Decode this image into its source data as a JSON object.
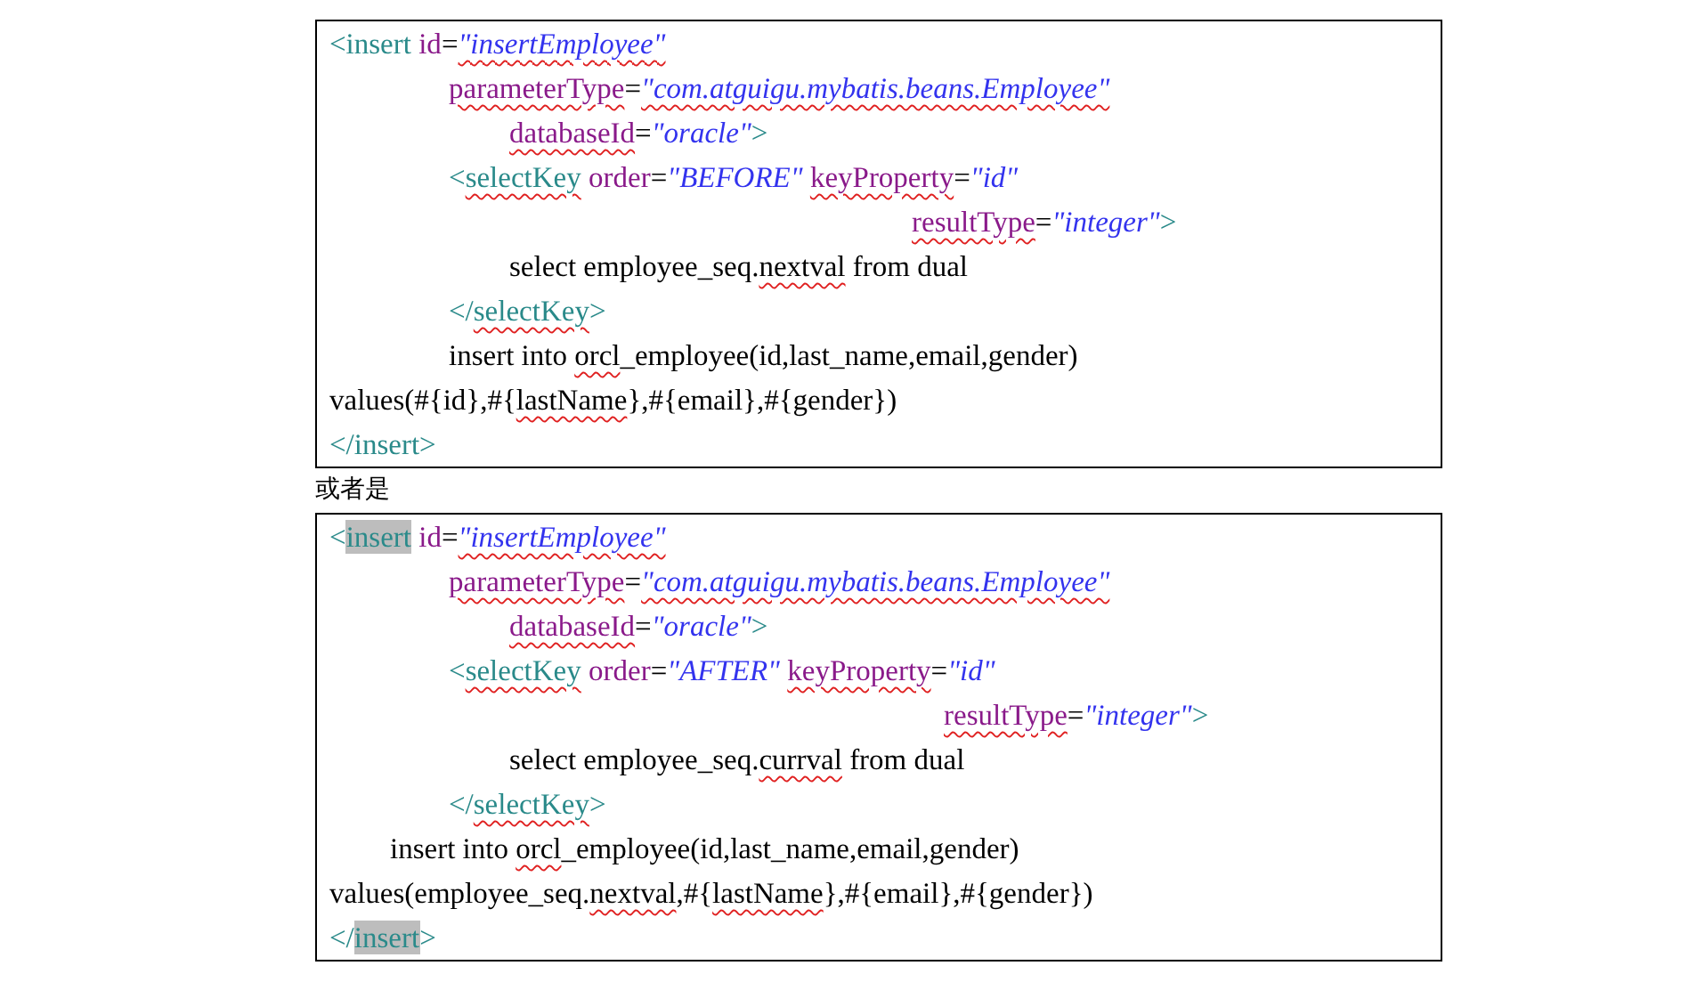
{
  "document": [
    {
      "kind": "code",
      "lines": [
        {
          "kind": "flush",
          "tokens": [
            {
              "text": "<insert",
              "kind": "tag",
              "misspelled": false,
              "highlighted": false
            },
            {
              "text": " id",
              "kind": "attr",
              "misspelled": false,
              "highlighted": false
            },
            {
              "text": "=",
              "kind": "plain",
              "misspelled": false,
              "highlighted": false
            },
            {
              "text": "\"insertEmployee\"",
              "kind": "value",
              "misspelled": true,
              "highlighted": false
            }
          ]
        },
        {
          "kind": "medium",
          "tokens": [
            {
              "text": "parameterType",
              "kind": "attr",
              "misspelled": true,
              "highlighted": false
            },
            {
              "text": "=",
              "kind": "plain",
              "misspelled": false,
              "highlighted": false
            },
            {
              "text": "\"com.atguigu.mybatis.beans.Employee\"",
              "kind": "value",
              "misspelled": true,
              "highlighted": false
            }
          ]
        },
        {
          "kind": "deep",
          "tokens": [
            {
              "text": "databaseId",
              "kind": "attr",
              "misspelled": true,
              "highlighted": false
            },
            {
              "text": "=",
              "kind": "plain",
              "misspelled": false,
              "highlighted": false
            },
            {
              "text": "\"oracle\"",
              "kind": "value",
              "misspelled": false,
              "highlighted": false
            },
            {
              "text": ">",
              "kind": "tag",
              "misspelled": false,
              "highlighted": false
            }
          ]
        },
        {
          "kind": "medium",
          "tokens": [
            {
              "text": "<",
              "kind": "tag",
              "misspelled": false,
              "highlighted": false
            },
            {
              "text": "selectKey",
              "kind": "tag",
              "misspelled": true,
              "highlighted": false
            },
            {
              "text": " order",
              "kind": "attr",
              "misspelled": false,
              "highlighted": false
            },
            {
              "text": "=",
              "kind": "plain",
              "misspelled": false,
              "highlighted": false
            },
            {
              "text": "\"BEFORE\" ",
              "kind": "value",
              "misspelled": false,
              "highlighted": false
            },
            {
              "text": "keyProperty",
              "kind": "attr",
              "misspelled": true,
              "highlighted": false
            },
            {
              "text": "=",
              "kind": "plain",
              "misspelled": false,
              "highlighted": false
            },
            {
              "text": "\"id\"",
              "kind": "value",
              "misspelled": false,
              "highlighted": false
            }
          ]
        },
        {
          "kind": "far",
          "tokens": [
            {
              "text": "resultType",
              "kind": "attr",
              "misspelled": true,
              "highlighted": false
            },
            {
              "text": "=",
              "kind": "plain",
              "misspelled": false,
              "highlighted": false
            },
            {
              "text": "\"integer\"",
              "kind": "value",
              "misspelled": false,
              "highlighted": false
            },
            {
              "text": ">",
              "kind": "tag",
              "misspelled": false,
              "highlighted": false
            }
          ]
        },
        {
          "kind": "deep",
          "tokens": [
            {
              "text": "select employee_seq.",
              "kind": "plain",
              "misspelled": false,
              "highlighted": false
            },
            {
              "text": "nextval",
              "kind": "plain",
              "misspelled": true,
              "highlighted": false
            },
            {
              "text": " from dual",
              "kind": "plain",
              "misspelled": false,
              "highlighted": false
            }
          ]
        },
        {
          "kind": "medium",
          "tokens": [
            {
              "text": "</",
              "kind": "tag",
              "misspelled": false,
              "highlighted": false
            },
            {
              "text": "selectKey",
              "kind": "tag",
              "misspelled": true,
              "highlighted": false
            },
            {
              "text": ">",
              "kind": "tag",
              "misspelled": false,
              "highlighted": false
            }
          ]
        },
        {
          "kind": "medium",
          "tokens": [
            {
              "text": "insert into ",
              "kind": "plain",
              "misspelled": false,
              "highlighted": false
            },
            {
              "text": "orcl",
              "kind": "plain",
              "misspelled": true,
              "highlighted": false
            },
            {
              "text": "_employee(id,last_name,email,gender)",
              "kind": "plain",
              "misspelled": false,
              "highlighted": false
            }
          ]
        },
        {
          "kind": "flush",
          "tokens": [
            {
              "text": "values(#{id},#{",
              "kind": "plain",
              "misspelled": false,
              "highlighted": false
            },
            {
              "text": "lastName",
              "kind": "plain",
              "misspelled": true,
              "highlighted": false
            },
            {
              "text": "},#{email},#{gender})",
              "kind": "plain",
              "misspelled": false,
              "highlighted": false
            }
          ]
        },
        {
          "kind": "flush",
          "tokens": [
            {
              "text": "</insert>",
              "kind": "tag",
              "misspelled": false,
              "highlighted": false
            }
          ]
        }
      ]
    },
    {
      "kind": "text",
      "text": "或者是"
    },
    {
      "kind": "code",
      "lines": [
        {
          "kind": "flush",
          "tokens": [
            {
              "text": "<",
              "kind": "tag",
              "misspelled": false,
              "highlighted": false
            },
            {
              "text": "insert",
              "kind": "tag",
              "misspelled": false,
              "highlighted": true
            },
            {
              "text": " id",
              "kind": "attr",
              "misspelled": false,
              "highlighted": false
            },
            {
              "text": "=",
              "kind": "plain",
              "misspelled": false,
              "highlighted": false
            },
            {
              "text": "\"insertEmployee\"",
              "kind": "value",
              "misspelled": true,
              "highlighted": false
            }
          ]
        },
        {
          "kind": "medium",
          "tokens": [
            {
              "text": "parameterType",
              "kind": "attr",
              "misspelled": true,
              "highlighted": false
            },
            {
              "text": "=",
              "kind": "plain",
              "misspelled": false,
              "highlighted": false
            },
            {
              "text": "\"com.atguigu.mybatis.beans.Employee\"",
              "kind": "value",
              "misspelled": true,
              "highlighted": false
            }
          ]
        },
        {
          "kind": "deep",
          "tokens": [
            {
              "text": "databaseId",
              "kind": "attr",
              "misspelled": true,
              "highlighted": false
            },
            {
              "text": "=",
              "kind": "plain",
              "misspelled": false,
              "highlighted": false
            },
            {
              "text": "\"oracle\"",
              "kind": "value",
              "misspelled": false,
              "highlighted": false
            },
            {
              "text": ">",
              "kind": "tag",
              "misspelled": false,
              "highlighted": false
            }
          ]
        },
        {
          "kind": "medium",
          "tokens": [
            {
              "text": "<",
              "kind": "tag",
              "misspelled": false,
              "highlighted": false
            },
            {
              "text": "selectKey",
              "kind": "tag",
              "misspelled": true,
              "highlighted": false
            },
            {
              "text": " order",
              "kind": "attr",
              "misspelled": false,
              "highlighted": false
            },
            {
              "text": "=",
              "kind": "plain",
              "misspelled": false,
              "highlighted": false
            },
            {
              "text": "\"AFTER\" ",
              "kind": "value",
              "misspelled": false,
              "highlighted": false
            },
            {
              "text": "keyProperty",
              "kind": "attr",
              "misspelled": true,
              "highlighted": false
            },
            {
              "text": "=",
              "kind": "plain",
              "misspelled": false,
              "highlighted": false
            },
            {
              "text": "\"id\"",
              "kind": "value",
              "misspelled": false,
              "highlighted": false
            }
          ]
        },
        {
          "kind": "farther",
          "tokens": [
            {
              "text": "resultType",
              "kind": "attr",
              "misspelled": true,
              "highlighted": false
            },
            {
              "text": "=",
              "kind": "plain",
              "misspelled": false,
              "highlighted": false
            },
            {
              "text": "\"integer\"",
              "kind": "value",
              "misspelled": false,
              "highlighted": false
            },
            {
              "text": ">",
              "kind": "tag",
              "misspelled": false,
              "highlighted": false
            }
          ]
        },
        {
          "kind": "deep",
          "tokens": [
            {
              "text": "select employee_seq.",
              "kind": "plain",
              "misspelled": false,
              "highlighted": false
            },
            {
              "text": "currval",
              "kind": "plain",
              "misspelled": true,
              "highlighted": false
            },
            {
              "text": " from dual",
              "kind": "plain",
              "misspelled": false,
              "highlighted": false
            }
          ]
        },
        {
          "kind": "medium",
          "tokens": [
            {
              "text": "</",
              "kind": "tag",
              "misspelled": false,
              "highlighted": false
            },
            {
              "text": "selectKey",
              "kind": "tag",
              "misspelled": true,
              "highlighted": false
            },
            {
              "text": ">",
              "kind": "tag",
              "misspelled": false,
              "highlighted": false
            }
          ]
        },
        {
          "kind": "short",
          "tokens": [
            {
              "text": "insert into ",
              "kind": "plain",
              "misspelled": false,
              "highlighted": false
            },
            {
              "text": "orcl",
              "kind": "plain",
              "misspelled": true,
              "highlighted": false
            },
            {
              "text": "_employee(id,last_name,email,gender)",
              "kind": "plain",
              "misspelled": false,
              "highlighted": false
            }
          ]
        },
        {
          "kind": "flush",
          "tokens": [
            {
              "text": "values(employee_seq.",
              "kind": "plain",
              "misspelled": false,
              "highlighted": false
            },
            {
              "text": "nextval",
              "kind": "plain",
              "misspelled": true,
              "highlighted": false
            },
            {
              "text": ",#{",
              "kind": "plain",
              "misspelled": false,
              "highlighted": false
            },
            {
              "text": "lastName",
              "kind": "plain",
              "misspelled": true,
              "highlighted": false
            },
            {
              "text": "},#{email},#{gender})",
              "kind": "plain",
              "misspelled": false,
              "highlighted": false
            }
          ]
        },
        {
          "kind": "flush",
          "tokens": [
            {
              "text": "</",
              "kind": "tag",
              "misspelled": false,
              "highlighted": false
            },
            {
              "text": "insert",
              "kind": "tag",
              "misspelled": false,
              "highlighted": true
            },
            {
              "text": ">",
              "kind": "tag",
              "misspelled": false,
              "highlighted": false
            }
          ]
        }
      ]
    }
  ]
}
